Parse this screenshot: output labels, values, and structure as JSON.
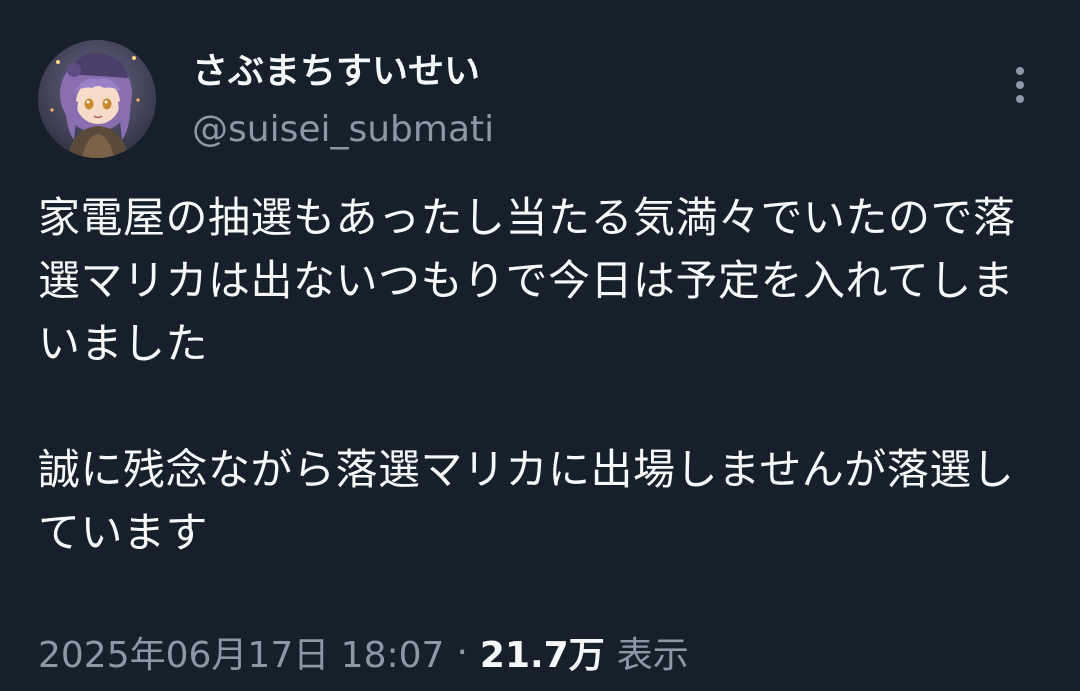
{
  "author": {
    "display_name": "さぶまちすいせい",
    "handle": "@suisei_submati",
    "avatar_icon": "anime-character-avatar"
  },
  "more_icon": "more-vertical-icon",
  "tweet": {
    "text": "家電屋の抽選もあったし当たる気満々でいたので落選マリカは出ないつもりで今日は予定を入れてしまいました\n\n誠に残念ながら落選マリカに出場しませんが落選しています"
  },
  "meta": {
    "timestamp": "2025年06月17日 18:07",
    "separator": "·",
    "views_count": "21.7万",
    "views_label": "表示"
  },
  "colors": {
    "background": "#15202b",
    "primary_text": "#f7f9f9",
    "secondary_text": "#8b98a5"
  }
}
